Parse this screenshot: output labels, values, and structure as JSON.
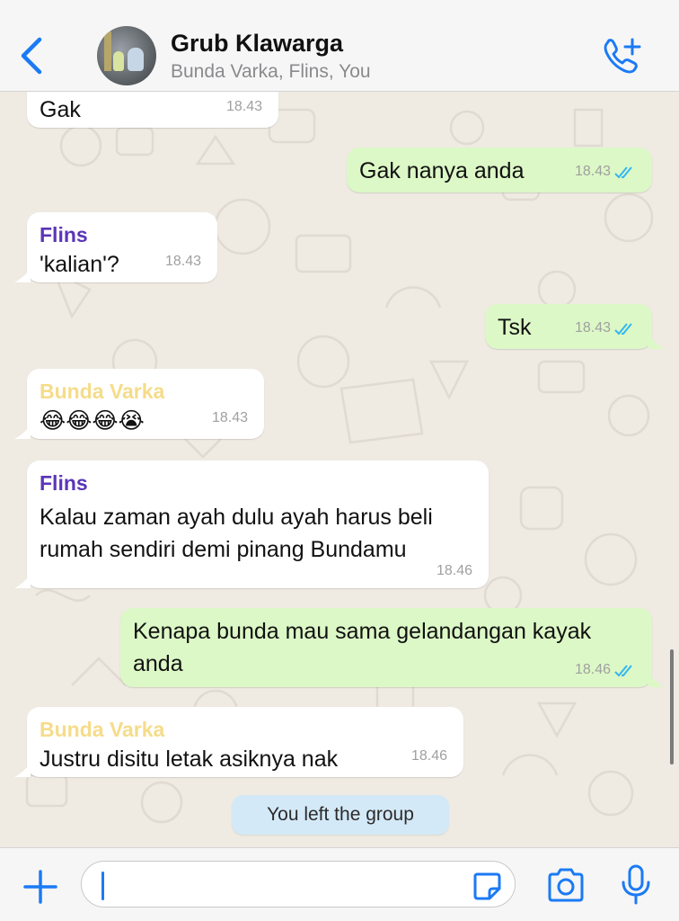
{
  "header": {
    "title": "Grub Klawarga",
    "subtitle": "Bunda Varka, Flins, You"
  },
  "colors": {
    "accent": "#1b7af5",
    "outgoing_bubble": "#dcf8c6",
    "incoming_bubble": "#ffffff",
    "sender_flins": "#5a36b8",
    "sender_bunda_varka": "#f5dc8a",
    "read_ticks": "#34b7f1",
    "system_bubble": "#d4e9f7"
  },
  "messages": [
    {
      "direction": "in",
      "sender": "",
      "text": "Gak",
      "time": "18.43"
    },
    {
      "direction": "out",
      "text": "Gak nanya anda",
      "time": "18.43",
      "status": "read"
    },
    {
      "direction": "in",
      "sender": "Flins",
      "text": "'kalian'?",
      "time": "18.43"
    },
    {
      "direction": "out",
      "text": "Tsk",
      "time": "18.43",
      "status": "read"
    },
    {
      "direction": "in",
      "sender": "Bunda Varka",
      "text": "😂😂😂😭",
      "time": "18.43"
    },
    {
      "direction": "in",
      "sender": "Flins",
      "text_line1": "Kalau zaman ayah dulu ayah harus beli",
      "text_line2": "rumah sendiri demi pinang Bundamu",
      "time": "18.46"
    },
    {
      "direction": "out",
      "text_line1": "Kenapa bunda mau sama gelandangan kayak",
      "text_line2": "anda",
      "time": "18.46",
      "status": "read"
    },
    {
      "direction": "in",
      "sender": "Bunda Varka",
      "text": "Justru disitu letak asiknya nak",
      "time": "18.46"
    }
  ],
  "system_message": "You left the group",
  "composer": {
    "value": "",
    "placeholder": ""
  },
  "icons": {
    "back": "chevron-left-icon",
    "call": "phone-add-icon",
    "attach": "plus-icon",
    "sticker": "sticker-icon",
    "camera": "camera-icon",
    "mic": "microphone-icon"
  }
}
